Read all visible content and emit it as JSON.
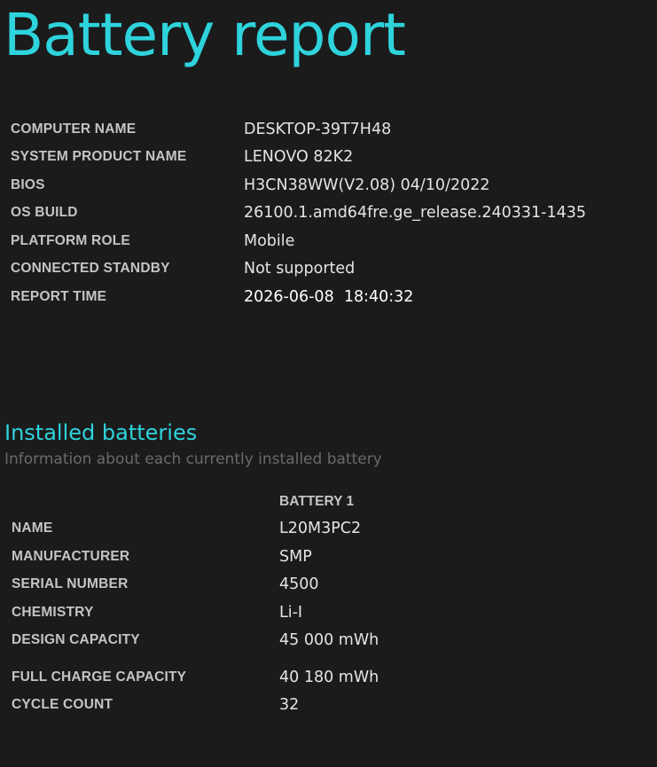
{
  "report": {
    "title": "Battery report",
    "info": [
      {
        "label": "COMPUTER NAME",
        "value": "DESKTOP-39T7H48"
      },
      {
        "label": "SYSTEM PRODUCT NAME",
        "value": "LENOVO 82K2"
      },
      {
        "label": "BIOS",
        "value": "H3CN38WW(V2.08) 04/10/2022"
      },
      {
        "label": "OS BUILD",
        "value": "26100.1.amd64fre.ge_release.240331-1435"
      },
      {
        "label": "PLATFORM ROLE",
        "value": "Mobile"
      },
      {
        "label": "CONNECTED STANDBY",
        "value": "Not supported"
      },
      {
        "label": "REPORT TIME",
        "value": "2026-06-08  18:40:32"
      }
    ]
  },
  "installed_batteries": {
    "title": "Installed batteries",
    "subtitle": "Information about each currently installed battery",
    "column_header": "BATTERY 1",
    "rows": [
      {
        "label": "NAME",
        "value": "L20M3PC2"
      },
      {
        "label": "MANUFACTURER",
        "value": "SMP"
      },
      {
        "label": "SERIAL NUMBER",
        "value": "4500"
      },
      {
        "label": "CHEMISTRY",
        "value": "Li-I"
      },
      {
        "label": "DESIGN CAPACITY",
        "value": "45 000 mWh"
      },
      {
        "label": "FULL CHARGE CAPACITY",
        "value": "40 180 mWh"
      },
      {
        "label": "CYCLE COUNT",
        "value": "32"
      }
    ]
  }
}
